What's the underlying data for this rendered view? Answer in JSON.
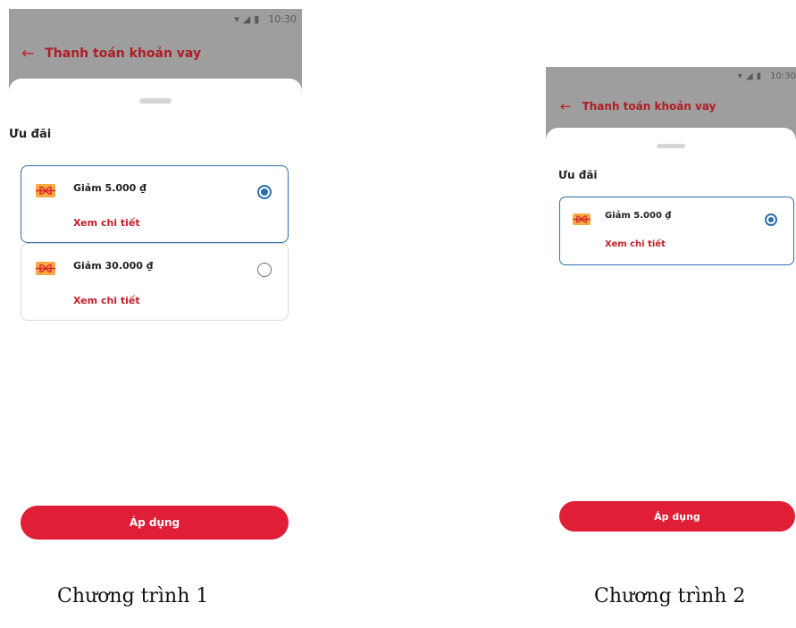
{
  "status_time": "10:30",
  "screen1": {
    "title": "Thanh toán khoản vay",
    "heading": "Ưu đãi",
    "offers": [
      {
        "label": "Giảm 5.000 ₫",
        "link": "Xem chi tiết",
        "selected": true
      },
      {
        "label": "Giảm 30.000 ₫",
        "link": "Xem chi tiết",
        "selected": false
      }
    ],
    "apply_label": "Áp dụng",
    "caption": "Chương trình 1"
  },
  "screen2": {
    "title": "Thanh toán khoản vay",
    "heading": "Ưu đãi",
    "offers": [
      {
        "label": "Giảm 5.000 ₫",
        "link": "Xem chi tiết",
        "selected": true
      }
    ],
    "apply_label": "Áp dụng",
    "caption": "Chương trình 2"
  },
  "colors": {
    "primary_red": "#e01f36",
    "title_red": "#b01c25",
    "selected_blue": "#2e6ea8",
    "voucher_orange": "#f7a940"
  },
  "icons": {
    "back": "arrow-left-icon",
    "voucher": "voucher-ribbon-icon",
    "wifi": "wifi-icon",
    "signal": "signal-icon",
    "battery": "battery-icon"
  }
}
